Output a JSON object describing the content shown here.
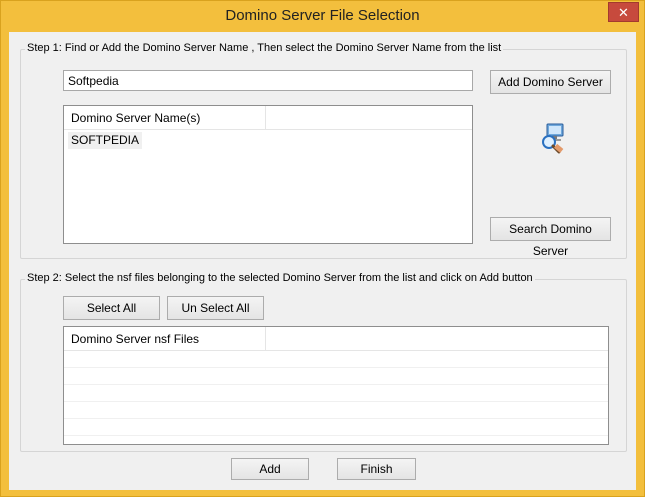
{
  "window": {
    "title": "Domino Server File Selection",
    "close_glyph": "✕"
  },
  "step1": {
    "legend": "Step 1: Find or Add the Domino Server Name , Then select the Domino Server Name from the list",
    "server_input_value": "Softpedia",
    "add_button": "Add Domino Server",
    "search_button": "Search Domino Server",
    "list": {
      "columns": [
        "Domino Server Name(s)",
        ""
      ],
      "items": [
        "SOFTPEDIA"
      ]
    },
    "icon": "server-search-icon"
  },
  "step2": {
    "legend": "Step 2: Select the nsf files belonging to the selected Domino Server from the list and click on Add button",
    "select_all_button": "Select All",
    "unselect_all_button": "Un Select All",
    "list": {
      "columns": [
        "Domino Server nsf Files",
        ""
      ],
      "items": []
    }
  },
  "footer": {
    "add_button": "Add",
    "finish_button": "Finish"
  },
  "colors": {
    "frame": "#f3bf3d",
    "close": "#c74a3d",
    "client": "#f0f0f0"
  }
}
